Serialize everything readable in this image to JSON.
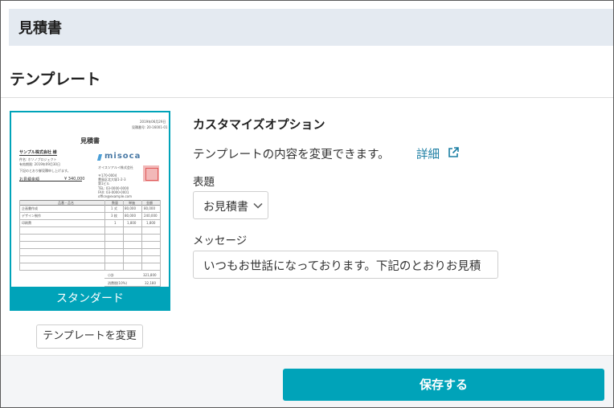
{
  "header": {
    "title": "見積書"
  },
  "template_section": {
    "title": "テンプレート",
    "template_name": "スタンダード",
    "change_button": "テンプレートを変更",
    "preview": {
      "date": "2019年06月29日",
      "doc_number": "見積番号: 20-16001-01",
      "title": "見積書",
      "customer": "サンプル株式会社 様",
      "subject_line": "件名: ホソノプロジェクト",
      "deadline_line": "有効期限: 2019年09月30日",
      "note_line": "下記のとおり御見積申し上げます。",
      "amount_label": "お見積金額",
      "amount": "¥ 340,000",
      "logo": "misoca",
      "company": "オイスツアルイ株式会社",
      "address1": "〒170-0004",
      "address2": "豊島区北大塚1-2-3",
      "address3": "第1ビル",
      "tel": "TEL: 03-0000-0000",
      "fax": "FAX: 03-0000-0001",
      "email": "office@example.com",
      "col_item": "品番・品名",
      "col_qty": "数量",
      "col_price": "単価",
      "col_amount": "金額",
      "row1": [
        "企画書作成",
        "1 式",
        "80,000",
        "80,000"
      ],
      "row2": [
        "デザイン制作",
        "3 枚",
        "80,000",
        "240,000"
      ],
      "row3": [
        "印刷費",
        "1",
        "1,800",
        "1,800"
      ],
      "subtotal_label": "小計",
      "subtotal": "321,800",
      "tax_label": "消費税(10%)",
      "tax": "32,180"
    }
  },
  "options": {
    "title": "カスタマイズオプション",
    "description": "テンプレートの内容を変更できます。",
    "detail_link": "詳細",
    "subject_label": "表題",
    "subject_value": "お見積書",
    "message_label": "メッセージ",
    "message_value": "いつもお世話になっております。下記のとおりお見積"
  },
  "footer": {
    "save_button": "保存する"
  },
  "colors": {
    "accent": "#00a3b9",
    "header_bg": "#e4eaf1",
    "link": "#1c7ea3"
  },
  "icons": {
    "external_link": "external-link-icon",
    "chevron": "chevron-down-icon"
  }
}
